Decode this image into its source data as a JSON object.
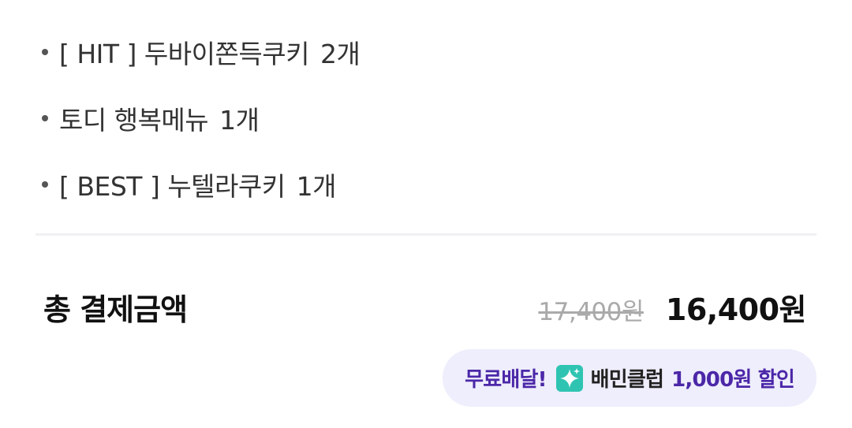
{
  "order_items": [
    {
      "name": "[ HIT ] 두바이쫀득쿠키",
      "qty": "2개"
    },
    {
      "name": "토디 행복메뉴",
      "qty": "1개"
    },
    {
      "name": "[ BEST ] 누텔라쿠키",
      "qty": "1개"
    }
  ],
  "total": {
    "label": "총 결제금액",
    "original_price": "17,400원",
    "final_price": "16,400원"
  },
  "promo": {
    "free_delivery": "무료배달!",
    "club_icon": "sparkle-badge-icon",
    "club_name": "배민클럽",
    "discount": "1,000원 할인",
    "accent_color": "#4b27a8",
    "badge_bg_color": "#eeeefc",
    "icon_color": "#2fc4b2"
  }
}
